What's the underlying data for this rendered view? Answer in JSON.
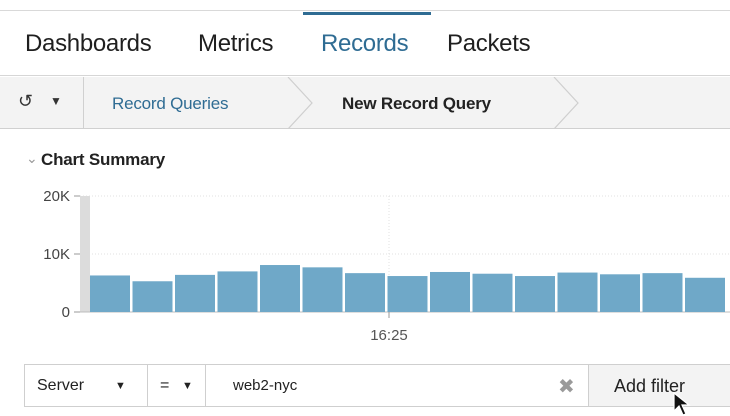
{
  "nav": {
    "tabs": [
      {
        "label": "Dashboards",
        "active": false
      },
      {
        "label": "Metrics",
        "active": false
      },
      {
        "label": "Records",
        "active": true
      },
      {
        "label": "Packets",
        "active": false
      }
    ]
  },
  "breadcrumb": {
    "history_icon": "history-icon",
    "items": [
      "Record Queries",
      "New Record Query"
    ]
  },
  "summary": {
    "title": "Chart Summary",
    "toggle_icon": "chevron-down-icon"
  },
  "chart_data": {
    "type": "bar",
    "y_ticks": [
      "20K",
      "10K",
      "0"
    ],
    "ylim": [
      0,
      20000
    ],
    "x_tick_label": "16:25",
    "values": [
      6300,
      5300,
      6400,
      7000,
      8100,
      7700,
      6700,
      6200,
      6900,
      6600,
      6200,
      6800,
      6500,
      6700,
      5900
    ],
    "bar_color": "#6fa8c8",
    "grid": true
  },
  "filter": {
    "field": "Server",
    "operator": "=",
    "value": "web2-nyc",
    "add_label": "Add filter"
  },
  "colors": {
    "accent": "#2f6c93",
    "bar": "#6fa8c8"
  }
}
